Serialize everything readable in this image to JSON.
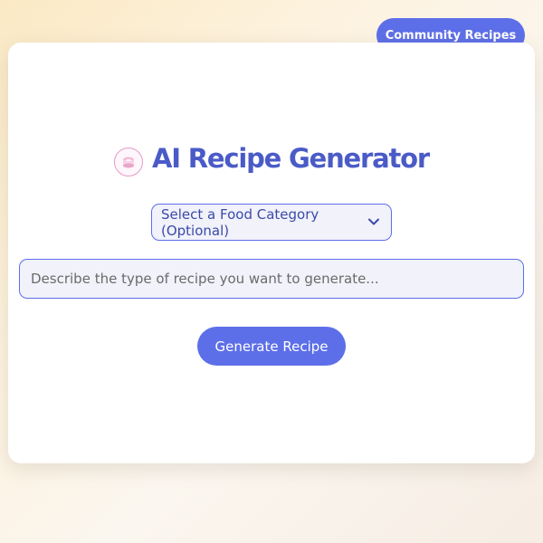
{
  "header": {
    "community_label": "Community Recipes"
  },
  "main": {
    "title": "AI Recipe Generator",
    "logo_icon": "recipe-logo-icon",
    "category_select": {
      "selected": "Select a Food Category (Optional)",
      "icon": "chevron-down-icon"
    },
    "prompt": {
      "value": "",
      "placeholder": "Describe the type of recipe you want to generate..."
    },
    "generate_label": "Generate Recipe"
  },
  "colors": {
    "accent": "#5d6fe8",
    "title": "#4a5bc7",
    "field_background": "#f1f2fa",
    "logo_ring": "#e59ac9"
  }
}
